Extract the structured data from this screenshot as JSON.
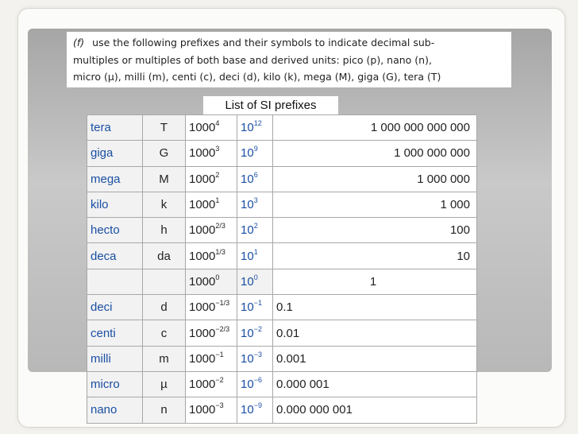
{
  "rule": {
    "marker": "(f)",
    "lines": [
      "use the following prefixes and their symbols to indicate decimal sub-",
      "multiples or multiples of both base and derived units: pico (p), nano (n),",
      "micro (µ), milli (m), centi (c), deci (d), kilo (k), mega (M), giga (G), tera (T)"
    ]
  },
  "caption": "List of SI prefixes",
  "rows": [
    {
      "name": "tera",
      "symbol": "T",
      "base": "1000",
      "base_exp": "4",
      "sci": "10",
      "sci_exp": "12",
      "value": "1 000 000 000 000"
    },
    {
      "name": "giga",
      "symbol": "G",
      "base": "1000",
      "base_exp": "3",
      "sci": "10",
      "sci_exp": "9",
      "value": "1 000 000 000"
    },
    {
      "name": "mega",
      "symbol": "M",
      "base": "1000",
      "base_exp": "2",
      "sci": "10",
      "sci_exp": "6",
      "value": "1 000 000"
    },
    {
      "name": "kilo",
      "symbol": "k",
      "base": "1000",
      "base_exp": "1",
      "sci": "10",
      "sci_exp": "3",
      "value": "1 000"
    },
    {
      "name": "hecto",
      "symbol": "h",
      "base": "1000",
      "base_exp": "2/3",
      "sci": "10",
      "sci_exp": "2",
      "value": "100"
    },
    {
      "name": "deca",
      "symbol": "da",
      "base": "1000",
      "base_exp": "1/3",
      "sci": "10",
      "sci_exp": "1",
      "value": "10"
    },
    {
      "name": "",
      "symbol": "",
      "base": "1000",
      "base_exp": "0",
      "sci": "10",
      "sci_exp": "0",
      "value": "1"
    },
    {
      "name": "deci",
      "symbol": "d",
      "base": "1000",
      "base_exp": "−1/3",
      "sci": "10",
      "sci_exp": "−1",
      "value": "0.1"
    },
    {
      "name": "centi",
      "symbol": "c",
      "base": "1000",
      "base_exp": "−2/3",
      "sci": "10",
      "sci_exp": "−2",
      "value": "0.01"
    },
    {
      "name": "milli",
      "symbol": "m",
      "base": "1000",
      "base_exp": "−1",
      "sci": "10",
      "sci_exp": "−3",
      "value": "0.001"
    },
    {
      "name": "micro",
      "symbol": "µ",
      "base": "1000",
      "base_exp": "−2",
      "sci": "10",
      "sci_exp": "−6",
      "value": "0.000 001"
    },
    {
      "name": "nano",
      "symbol": "n",
      "base": "1000",
      "base_exp": "−3",
      "sci": "10",
      "sci_exp": "−9",
      "value": "0.000 000 001"
    }
  ]
}
